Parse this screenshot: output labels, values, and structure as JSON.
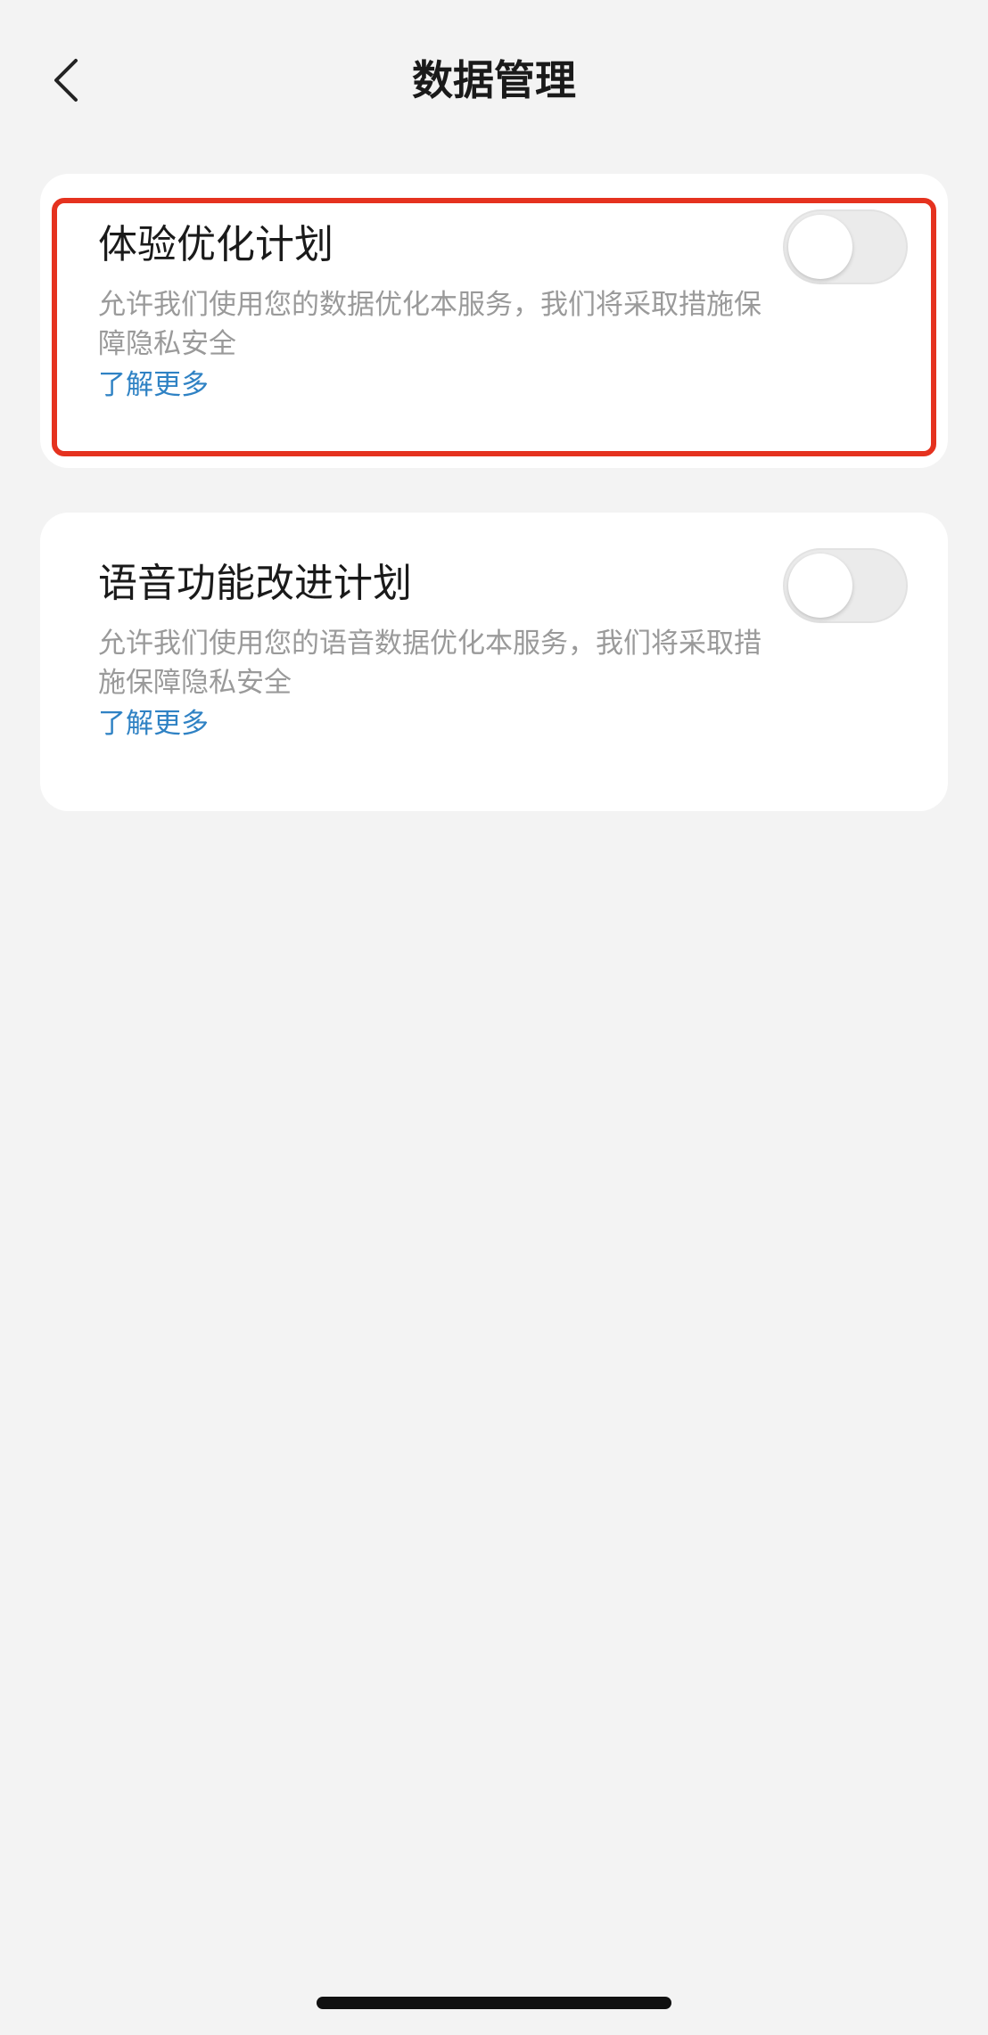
{
  "header": {
    "title": "数据管理",
    "back_icon": "chevron-left-icon"
  },
  "settings": [
    {
      "title": "体验优化计划",
      "description": "允许我们使用您的数据优化本服务，我们将采取措施保障隐私安全",
      "link": "了解更多",
      "enabled": false
    },
    {
      "title": "语音功能改进计划",
      "description": "允许我们使用您的语音数据优化本服务，我们将采取措施保障隐私安全",
      "link": "了解更多",
      "enabled": false
    }
  ],
  "colors": {
    "background": "#f3f3f3",
    "card": "#ffffff",
    "link": "#2f82c4",
    "highlight": "#e5321f",
    "toggle_off": "#ebebeb"
  }
}
